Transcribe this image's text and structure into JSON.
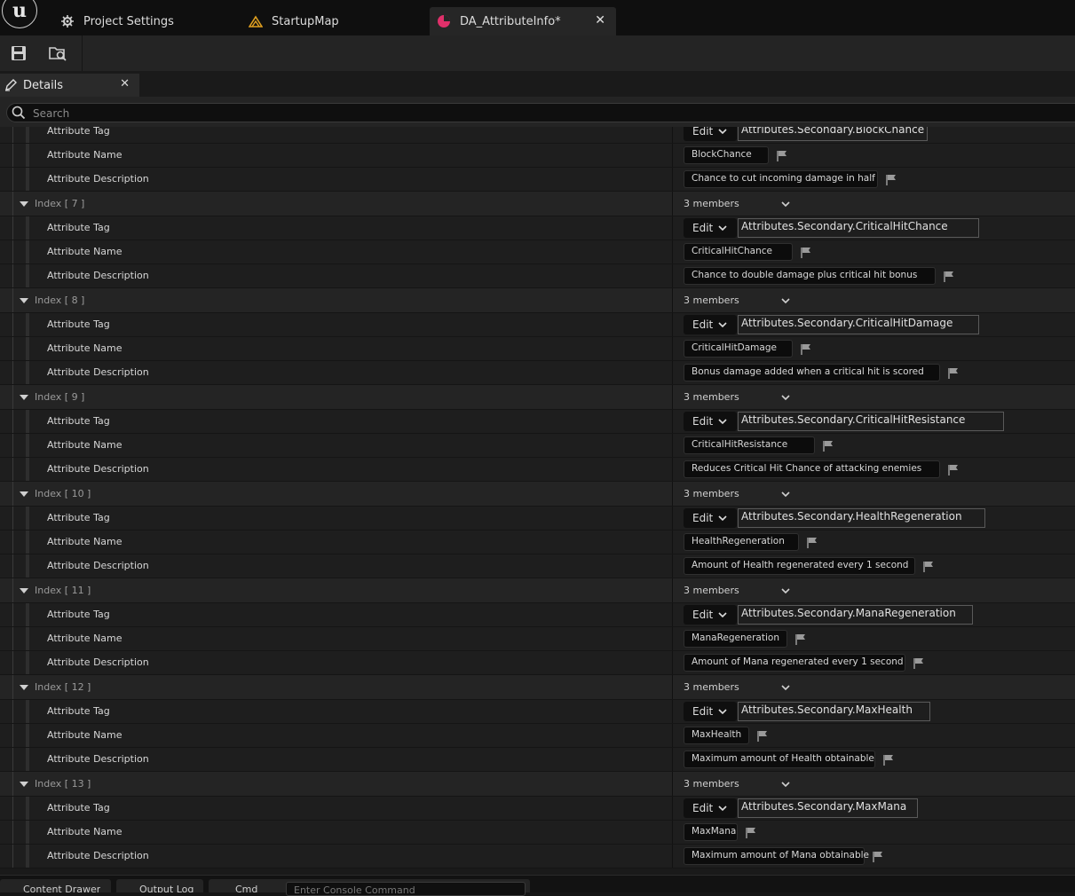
{
  "tabs": [
    {
      "label": "Project Settings",
      "icon": "settings-gear-icon"
    },
    {
      "label": "StartupMap",
      "icon": "level-map-icon"
    },
    {
      "label": "DA_AttributeInfo*",
      "icon": "data-asset-icon",
      "active": true
    }
  ],
  "toolbar": {
    "save_icon": "save-icon",
    "browse_icon": "browse-to-asset-icon"
  },
  "details": {
    "tab_label": "Details",
    "close_glyph": "✕",
    "search_placeholder": "Search"
  },
  "partial_top": {
    "tag_label": "Attribute Tag",
    "edit_label": "Edit",
    "tag_value": "Attributes.Secondary.BlockChance",
    "name_label": "Attribute Name",
    "name_value": "BlockChance",
    "desc_label": "Attribute Description",
    "desc_value": "Chance to cut incoming damage in half"
  },
  "entries": [
    {
      "index": "Index [ 7 ]",
      "members": "3 members",
      "tag_label": "Attribute Tag",
      "edit_label": "Edit",
      "tag": "Attributes.Secondary.CriticalHitChance",
      "name_label": "Attribute Name",
      "name": "CriticalHitChance",
      "desc_label": "Attribute Description",
      "desc": "Chance to double damage plus critical hit bonus"
    },
    {
      "index": "Index [ 8 ]",
      "members": "3 members",
      "tag_label": "Attribute Tag",
      "edit_label": "Edit",
      "tag": "Attributes.Secondary.CriticalHitDamage",
      "name_label": "Attribute Name",
      "name": "CriticalHitDamage",
      "desc_label": "Attribute Description",
      "desc": "Bonus damage added when a critical hit is scored"
    },
    {
      "index": "Index [ 9 ]",
      "members": "3 members",
      "tag_label": "Attribute Tag",
      "edit_label": "Edit",
      "tag": "Attributes.Secondary.CriticalHitResistance",
      "name_label": "Attribute Name",
      "name": "CriticalHitResistance",
      "desc_label": "Attribute Description",
      "desc": "Reduces Critical Hit Chance of attacking enemies"
    },
    {
      "index": "Index [ 10 ]",
      "members": "3 members",
      "tag_label": "Attribute Tag",
      "edit_label": "Edit",
      "tag": "Attributes.Secondary.HealthRegeneration",
      "name_label": "Attribute Name",
      "name": "HealthRegeneration",
      "desc_label": "Attribute Description",
      "desc": "Amount of Health regenerated every 1 second"
    },
    {
      "index": "Index [ 11 ]",
      "members": "3 members",
      "tag_label": "Attribute Tag",
      "edit_label": "Edit",
      "tag": "Attributes.Secondary.ManaRegeneration",
      "name_label": "Attribute Name",
      "name": "ManaRegeneration",
      "desc_label": "Attribute Description",
      "desc": "Amount of Mana regenerated every 1 second"
    },
    {
      "index": "Index [ 12 ]",
      "members": "3 members",
      "tag_label": "Attribute Tag",
      "edit_label": "Edit",
      "tag": "Attributes.Secondary.MaxHealth",
      "name_label": "Attribute Name",
      "name": "MaxHealth",
      "desc_label": "Attribute Description",
      "desc": "Maximum amount of Health obtainable"
    },
    {
      "index": "Index [ 13 ]",
      "members": "3 members",
      "tag_label": "Attribute Tag",
      "edit_label": "Edit",
      "tag": "Attributes.Secondary.MaxMana",
      "name_label": "Attribute Name",
      "name": "MaxMana",
      "desc_label": "Attribute Description",
      "desc": "Maximum amount of Mana obtainable"
    }
  ],
  "bottom_bar": {
    "content_drawer": "Content Drawer",
    "output_log": "Output Log",
    "cmd": "Cmd",
    "console_placeholder": "Enter Console Command"
  },
  "colors": {
    "accent_tab_icon": "#e0306a",
    "map_icon": "#e0a020",
    "panel_bg": "#1a1a1a"
  }
}
